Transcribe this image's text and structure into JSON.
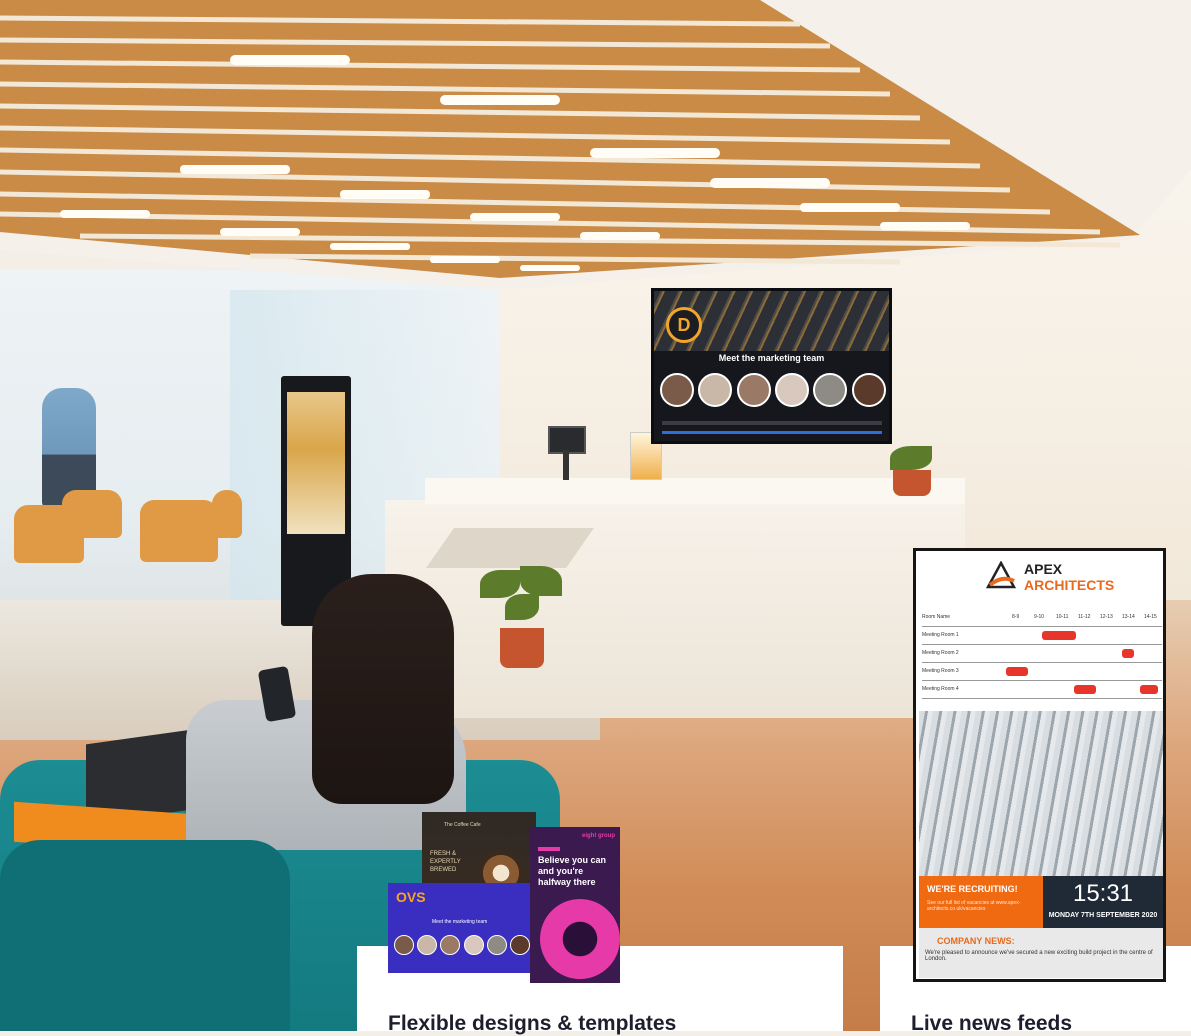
{
  "scene": {
    "description_label": ""
  },
  "wall_tv": {
    "logo_letter": "D",
    "title": "Meet the marketing team"
  },
  "portrait_screen": {
    "brand_line1": "APEX",
    "brand_line2": "ARCHITECTS",
    "table_header": [
      "Room Name",
      "8-9",
      "9-10",
      "10-11",
      "11-12",
      "12-13",
      "13-14",
      "14-15"
    ],
    "rooms": [
      "Meeting Room 1",
      "Meeting Room 2",
      "Meeting Room 3",
      "Meeting Room 4"
    ],
    "recruit_title": "WE'RE RECRUITING!",
    "recruit_text": "See our full list of vacancies at www.apex-architects.co.uk/vacancies",
    "clock_time": "15:31",
    "clock_date": "MONDAY 7TH SEPTEMBER 2020",
    "news_title": "COMPANY NEWS:",
    "news_text": "We're pleased to announce we've secured a new exciting build project in the centre of London."
  },
  "templates": {
    "coffee_brand": "The Coffee Cafe",
    "coffee_text": "FRESH & EXPERTLY BREWED",
    "ovs_logo": "OVS",
    "ovs_subtitle": "Meet the marketing team",
    "quote_brand": "eight group",
    "quote_text": "Believe you can and you're halfway there"
  },
  "cards": [
    {
      "title": "Flexible designs & templates"
    },
    {
      "title": "Live news feeds"
    }
  ],
  "colors": {
    "accent_orange": "#f06a12",
    "teal_sofa": "#137a80",
    "card_bg": "#ffffff",
    "card_title": "#1e1e2d"
  }
}
